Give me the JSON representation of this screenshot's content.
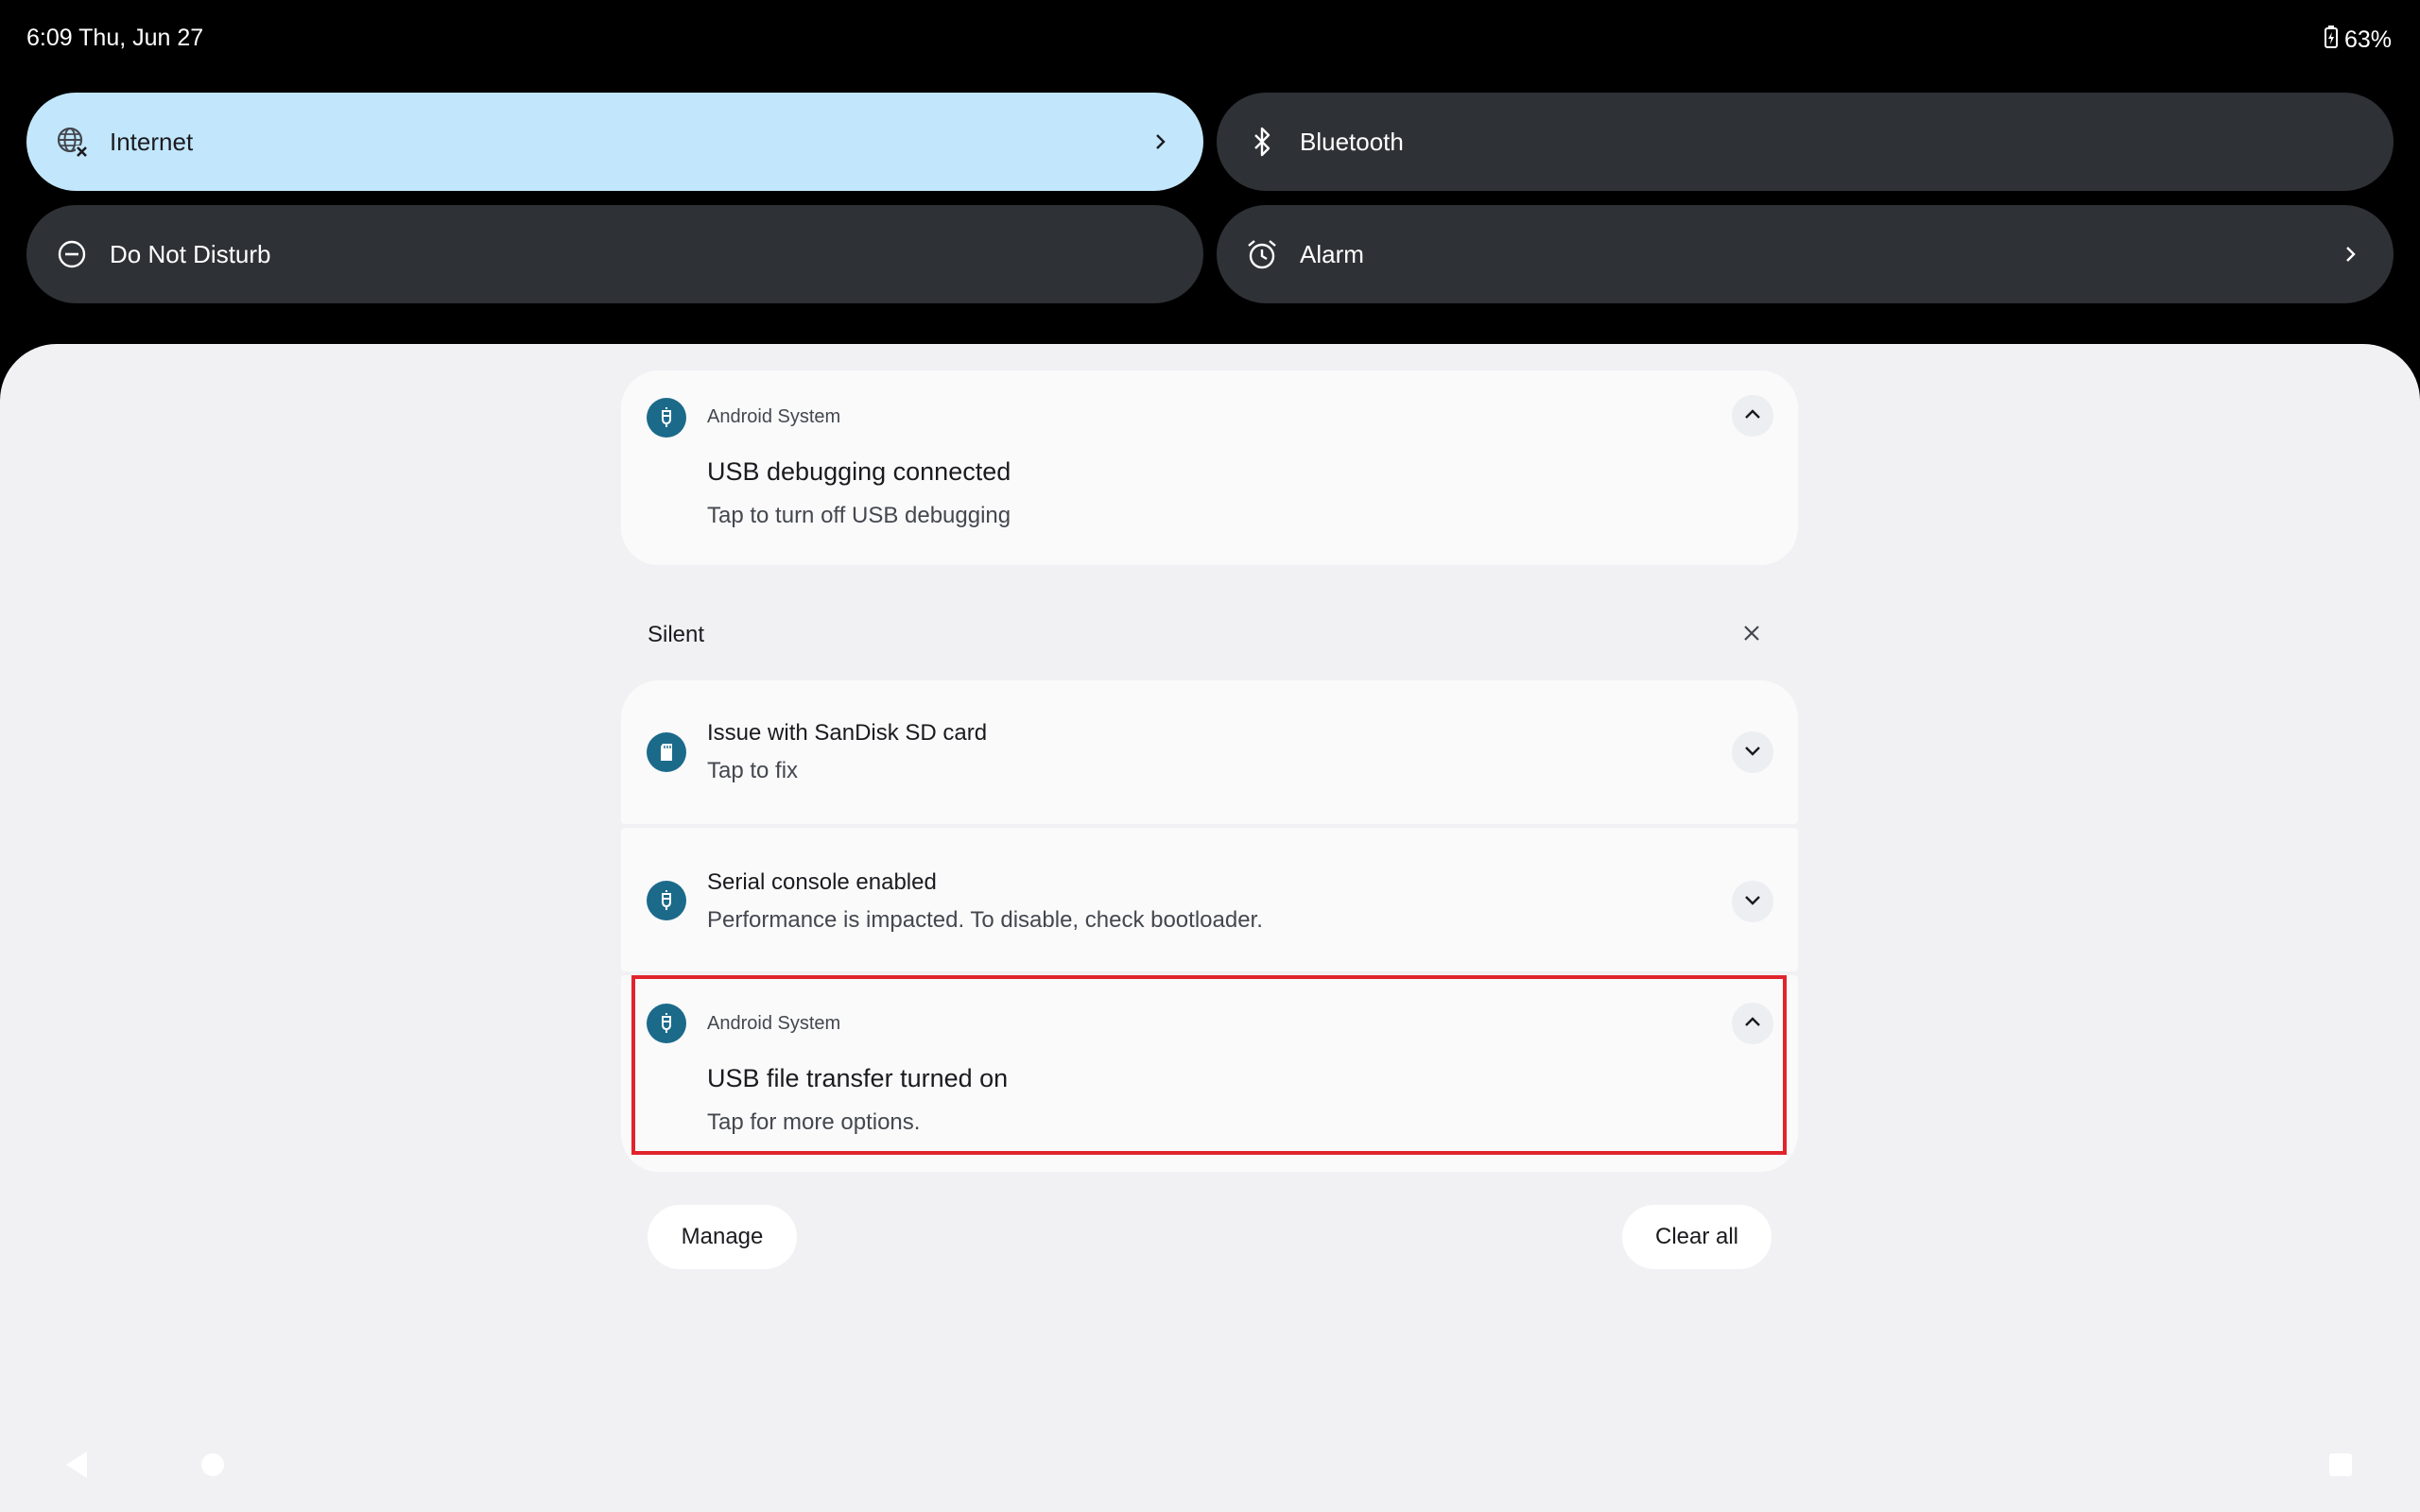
{
  "status_bar": {
    "time_date": "6:09  Thu, Jun 27",
    "battery_icon": "battery-charging-icon",
    "battery": "63%"
  },
  "quick_settings": {
    "tiles": [
      {
        "label": "Internet",
        "icon": "internet-off-icon",
        "state": "active",
        "has_chevron": true
      },
      {
        "label": "Bluetooth",
        "icon": "bluetooth-icon",
        "state": "inactive",
        "has_chevron": false
      },
      {
        "label": "Do Not Disturb",
        "icon": "do-not-disturb-icon",
        "state": "inactive",
        "has_chevron": false
      },
      {
        "label": "Alarm",
        "icon": "alarm-icon",
        "state": "inactive",
        "has_chevron": true
      }
    ]
  },
  "notifications": {
    "ongoing": {
      "app_name": "Android System",
      "title": "USB debugging connected",
      "text": "Tap to turn off USB debugging"
    },
    "silent_section_label": "Silent",
    "silent": [
      {
        "title": "Issue with SanDisk SD card",
        "text": "Tap to fix",
        "icon": "sd-card-icon"
      },
      {
        "title": "Serial console enabled",
        "text": "Performance is impacted. To disable, check bootloader.",
        "icon": "usb-icon"
      },
      {
        "app_name": "Android System",
        "title": "USB file transfer turned on",
        "text": "Tap for more options.",
        "icon": "usb-icon"
      }
    ]
  },
  "actions": {
    "manage": "Manage",
    "clear_all": "Clear all"
  },
  "colors": {
    "accent_tile": "#c2e7fc",
    "tile_dark": "#2e3135",
    "app_icon": "#1b6a8a",
    "highlight": "#e0242c",
    "shade_bg": "#f1f1f3"
  }
}
